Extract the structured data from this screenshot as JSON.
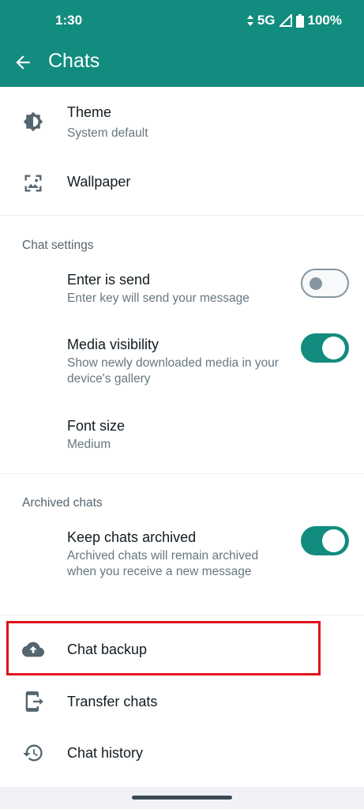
{
  "status": {
    "time": "1:30",
    "network": "5G",
    "battery": "100%"
  },
  "appbar": {
    "title": "Chats"
  },
  "display": {
    "theme": {
      "title": "Theme",
      "subtitle": "System default"
    },
    "wallpaper": {
      "title": "Wallpaper"
    }
  },
  "chat_settings": {
    "header": "Chat settings",
    "enter_is_send": {
      "title": "Enter is send",
      "subtitle": "Enter key will send your message",
      "enabled": false
    },
    "media_visibility": {
      "title": "Media visibility",
      "subtitle": "Show newly downloaded media in your device's gallery",
      "enabled": true
    },
    "font_size": {
      "title": "Font size",
      "subtitle": "Medium"
    }
  },
  "archived": {
    "header": "Archived chats",
    "keep_archived": {
      "title": "Keep chats archived",
      "subtitle": "Archived chats will remain archived when you receive a new message",
      "enabled": true
    }
  },
  "actions": {
    "chat_backup": "Chat backup",
    "transfer_chats": "Transfer chats",
    "chat_history": "Chat history"
  },
  "colors": {
    "accent": "#128c7e",
    "highlight": "#e0121b",
    "icon": "#54656f"
  },
  "icons": {
    "back": "arrow-left-icon",
    "theme": "brightness-icon",
    "wallpaper": "wallpaper-icon",
    "backup": "cloud-upload-icon",
    "transfer": "transfer-phone-icon",
    "history": "history-icon"
  }
}
